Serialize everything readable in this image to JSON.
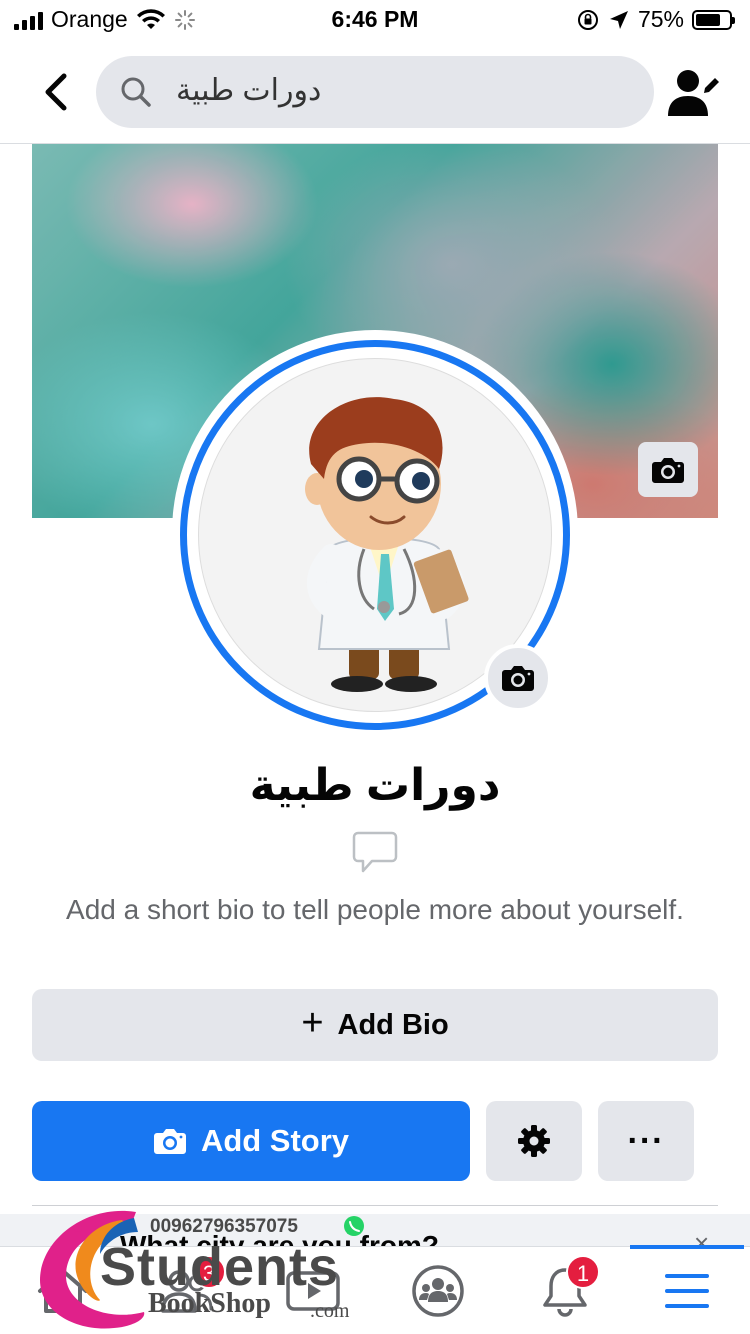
{
  "status_bar": {
    "carrier": "Orange",
    "time": "6:46 PM",
    "battery": "75%",
    "battery_level": 0.75
  },
  "nav": {
    "back_icon": "chevron-left-icon",
    "search_text": "دورات طبية",
    "edit_icon": "edit-profile-icon"
  },
  "profile": {
    "name": "دورات طبية",
    "bio_hint": "Add a short bio to tell people more about yourself.",
    "add_bio_label": "Add Bio",
    "add_story_label": "Add Story",
    "more_label": "···"
  },
  "prompt": {
    "text": "What city are you from?",
    "close": "×"
  },
  "tabs": {
    "items": [
      {
        "name": "home",
        "icon": "home-icon"
      },
      {
        "name": "friends",
        "icon": "friends-icon",
        "badge": "3"
      },
      {
        "name": "watch",
        "icon": "watch-icon"
      },
      {
        "name": "groups",
        "icon": "groups-icon"
      },
      {
        "name": "notifications",
        "icon": "bell-icon",
        "badge": "1"
      },
      {
        "name": "menu",
        "icon": "menu-icon",
        "active": true
      }
    ],
    "friends_badge": "3",
    "notifications_badge": "1"
  },
  "watermark": {
    "phone": "00962796357075",
    "line1": "Students",
    "line2": "BookShop",
    "suffix": ".com"
  },
  "colors": {
    "accent": "#1877f2",
    "badge": "#e41e3f",
    "button_gray": "#e4e6eb",
    "secondary_text": "#65676b"
  }
}
